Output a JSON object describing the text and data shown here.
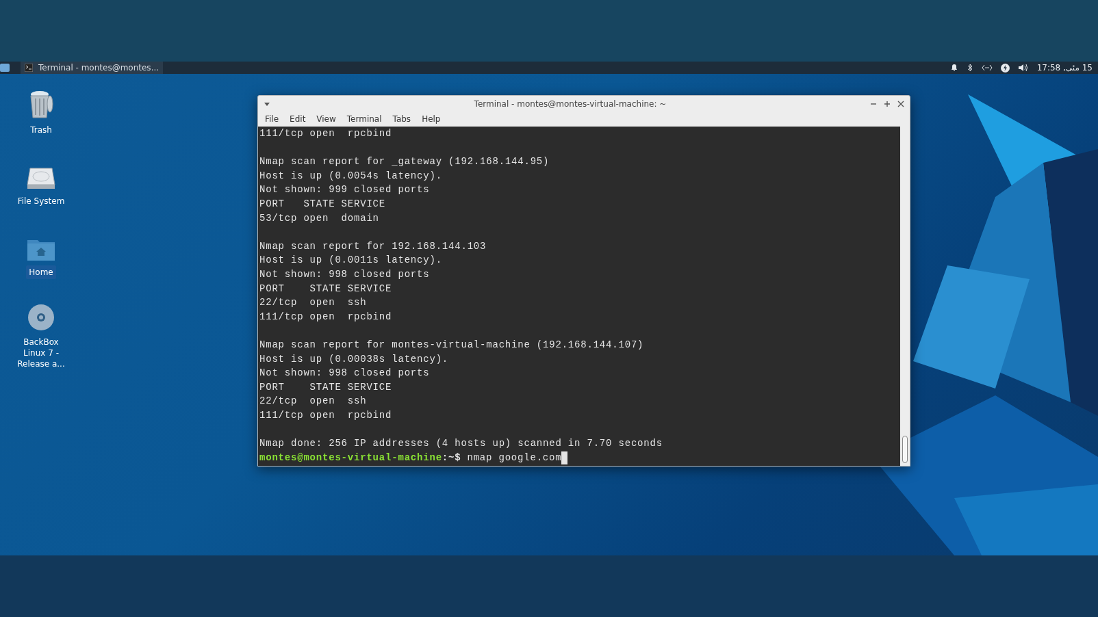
{
  "panel": {
    "task": {
      "label": "Terminal - montes@montes...",
      "selected": true
    },
    "clock": "15 مئی, 17:58"
  },
  "desktop_icons": [
    {
      "kind": "trash",
      "label": "Trash",
      "selected": false
    },
    {
      "kind": "drive",
      "label": "File System",
      "selected": false
    },
    {
      "kind": "home",
      "label": "Home",
      "selected": true
    },
    {
      "kind": "disc",
      "label": "BackBox Linux 7 - Release a...",
      "selected": false
    }
  ],
  "window": {
    "title": "Terminal - montes@montes-virtual-machine: ~",
    "menu": [
      "File",
      "Edit",
      "View",
      "Terminal",
      "Tabs",
      "Help"
    ],
    "lines": [
      {
        "kind": "output",
        "text": "111/tcp open  rpcbind"
      },
      {
        "kind": "blank"
      },
      {
        "kind": "output",
        "text": "Nmap scan report for _gateway (192.168.144.95)"
      },
      {
        "kind": "output",
        "text": "Host is up (0.0054s latency)."
      },
      {
        "kind": "output",
        "text": "Not shown: 999 closed ports"
      },
      {
        "kind": "output",
        "text": "PORT   STATE SERVICE"
      },
      {
        "kind": "output",
        "text": "53/tcp open  domain"
      },
      {
        "kind": "blank"
      },
      {
        "kind": "output",
        "text": "Nmap scan report for 192.168.144.103"
      },
      {
        "kind": "output",
        "text": "Host is up (0.0011s latency)."
      },
      {
        "kind": "output",
        "text": "Not shown: 998 closed ports"
      },
      {
        "kind": "output",
        "text": "PORT    STATE SERVICE"
      },
      {
        "kind": "output",
        "text": "22/tcp  open  ssh"
      },
      {
        "kind": "output",
        "text": "111/tcp open  rpcbind"
      },
      {
        "kind": "blank"
      },
      {
        "kind": "output",
        "text": "Nmap scan report for montes-virtual-machine (192.168.144.107)"
      },
      {
        "kind": "output",
        "text": "Host is up (0.00038s latency)."
      },
      {
        "kind": "output",
        "text": "Not shown: 998 closed ports"
      },
      {
        "kind": "output",
        "text": "PORT    STATE SERVICE"
      },
      {
        "kind": "output",
        "text": "22/tcp  open  ssh"
      },
      {
        "kind": "output",
        "text": "111/tcp open  rpcbind"
      },
      {
        "kind": "blank"
      },
      {
        "kind": "output",
        "text": "Nmap done: 256 IP addresses (4 hosts up) scanned in 7.70 seconds"
      },
      {
        "kind": "prompt",
        "user": "montes@montes-virtual-machine",
        "path": ":~$",
        "command": "nmap google.com"
      }
    ]
  }
}
